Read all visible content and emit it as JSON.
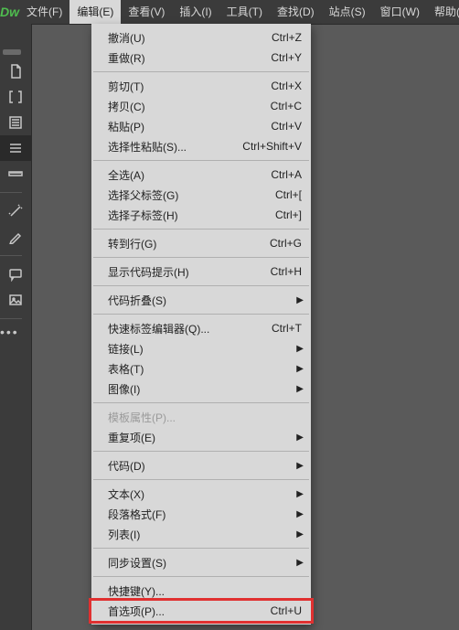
{
  "app": {
    "logo": "Dw"
  },
  "menubar": {
    "items": [
      {
        "label": "文件(F)"
      },
      {
        "label": "编辑(E)",
        "active": true
      },
      {
        "label": "查看(V)"
      },
      {
        "label": "插入(I)"
      },
      {
        "label": "工具(T)"
      },
      {
        "label": "查找(D)"
      },
      {
        "label": "站点(S)"
      },
      {
        "label": "窗口(W)"
      },
      {
        "label": "帮助(H)"
      }
    ]
  },
  "tools": {
    "names": [
      "file-icon",
      "brackets-icon",
      "list-icon",
      "lines-icon",
      "ruler-icon",
      "wand-icon",
      "pen-icon",
      "comment-icon",
      "image-icon"
    ]
  },
  "menu_groups": [
    [
      {
        "label": "撤消(U)",
        "shortcut": "Ctrl+Z"
      },
      {
        "label": "重做(R)",
        "shortcut": "Ctrl+Y"
      }
    ],
    [
      {
        "label": "剪切(T)",
        "shortcut": "Ctrl+X"
      },
      {
        "label": "拷贝(C)",
        "shortcut": "Ctrl+C"
      },
      {
        "label": "粘贴(P)",
        "shortcut": "Ctrl+V"
      },
      {
        "label": "选择性粘贴(S)...",
        "shortcut": "Ctrl+Shift+V"
      }
    ],
    [
      {
        "label": "全选(A)",
        "shortcut": "Ctrl+A"
      },
      {
        "label": "选择父标签(G)",
        "shortcut": "Ctrl+["
      },
      {
        "label": "选择子标签(H)",
        "shortcut": "Ctrl+]"
      }
    ],
    [
      {
        "label": "转到行(G)",
        "shortcut": "Ctrl+G"
      }
    ],
    [
      {
        "label": "显示代码提示(H)",
        "shortcut": "Ctrl+H"
      }
    ],
    [
      {
        "label": "代码折叠(S)",
        "submenu": true
      }
    ],
    [
      {
        "label": "快速标签编辑器(Q)...",
        "shortcut": "Ctrl+T"
      },
      {
        "label": "链接(L)",
        "submenu": true
      },
      {
        "label": "表格(T)",
        "submenu": true
      },
      {
        "label": "图像(I)",
        "submenu": true
      }
    ],
    [
      {
        "label": "模板属性(P)...",
        "disabled": true
      },
      {
        "label": "重复项(E)",
        "submenu": true
      }
    ],
    [
      {
        "label": "代码(D)",
        "submenu": true
      }
    ],
    [
      {
        "label": "文本(X)",
        "submenu": true
      },
      {
        "label": "段落格式(F)",
        "submenu": true
      },
      {
        "label": "列表(I)",
        "submenu": true
      }
    ],
    [
      {
        "label": "同步设置(S)",
        "submenu": true
      }
    ],
    [
      {
        "label": "快捷键(Y)..."
      },
      {
        "label": "首选项(P)...",
        "shortcut": "Ctrl+U",
        "highlighted": true
      }
    ]
  ]
}
